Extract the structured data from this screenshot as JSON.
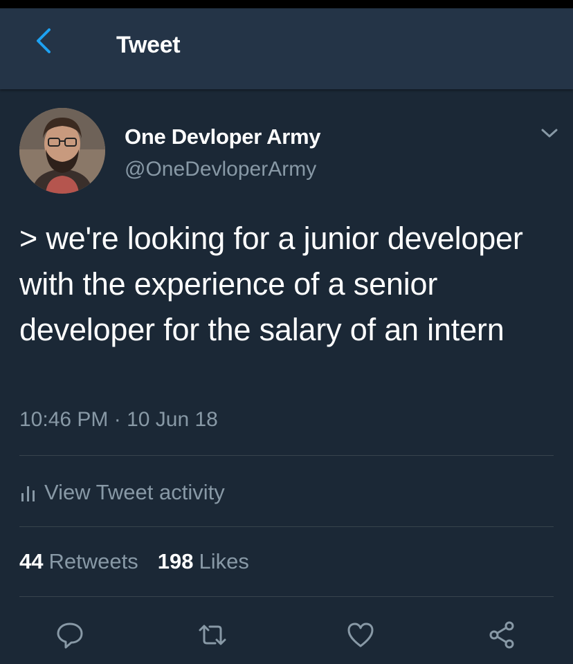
{
  "header": {
    "title": "Tweet",
    "back_icon": "back-chevron-icon"
  },
  "author": {
    "display_name": "One Devloper Army",
    "handle": "@OneDevloperArmy",
    "menu_icon": "chevron-down-icon"
  },
  "tweet": {
    "text": "> we're looking for a junior developer with the experience of a senior developer for the salary of an intern",
    "timestamp": "10:46 PM · 10 Jun 18"
  },
  "activity": {
    "label": "View Tweet activity",
    "icon": "bar-chart-icon"
  },
  "stats": {
    "retweets_count": "44",
    "retweets_label": "Retweets",
    "likes_count": "198",
    "likes_label": "Likes"
  },
  "actions": [
    {
      "name": "reply",
      "icon": "comment-icon"
    },
    {
      "name": "retweet",
      "icon": "retweet-icon"
    },
    {
      "name": "like",
      "icon": "heart-icon"
    },
    {
      "name": "share",
      "icon": "share-icon"
    }
  ],
  "colors": {
    "background": "#1b2836",
    "header": "#243447",
    "accent": "#1da1f2",
    "secondary_text": "#8899a6",
    "divider": "#38444d"
  }
}
